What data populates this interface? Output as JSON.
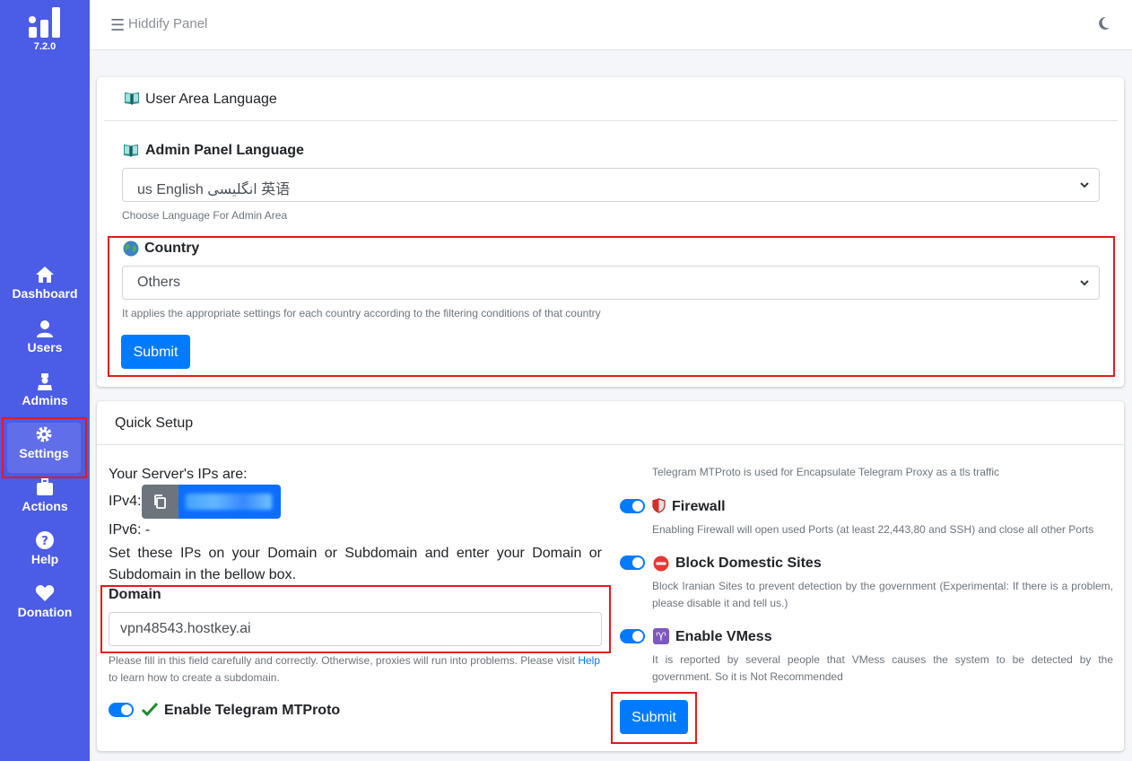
{
  "sidebar": {
    "version": "7.2.0",
    "items": [
      {
        "label": "Dashboard",
        "icon": "home-icon"
      },
      {
        "label": "Users",
        "icon": "user-icon"
      },
      {
        "label": "Admins",
        "icon": "admin-icon"
      },
      {
        "label": "Settings",
        "icon": "gear-icon",
        "active": true
      },
      {
        "label": "Actions",
        "icon": "briefcase-icon"
      },
      {
        "label": "Help",
        "icon": "question-icon"
      },
      {
        "label": "Donation",
        "icon": "heart-icon"
      }
    ]
  },
  "header": {
    "title": "Hiddify Panel"
  },
  "user_area": {
    "title": "User Area Language",
    "admin_lang_label": "Admin Panel Language",
    "admin_lang_value": "us English انگلیسی 英语",
    "admin_lang_help": "Choose Language For Admin Area",
    "country_label": "Country",
    "country_value": "Others",
    "country_help": "It applies the appropriate settings for each country according to the filtering conditions of that country",
    "submit": "Submit"
  },
  "quick_setup": {
    "title": "Quick Setup",
    "server_ips": "Your Server's IPs are:",
    "ipv4_label": "IPv4:",
    "ipv6_label": "IPv6: -",
    "instruction": "Set these IPs on your Domain or Subdomain and enter your Domain or Subdomain in the bellow box.",
    "domain_label": "Domain",
    "domain_value": "vpn48543.hostkey.ai",
    "domain_help_1": "Please fill in this field carefully and correctly. Otherwise, proxies will run into problems. Please visit",
    "domain_help_link": "Help",
    "domain_help_2": "to learn how to create a subdomain.",
    "telegram_label": "Enable Telegram MTProto",
    "telegram_help": "Telegram MTProto is used for Encapsulate Telegram Proxy as a tls traffic",
    "firewall_label": "Firewall",
    "firewall_help": "Enabling Firewall will open used Ports (at least 22,443,80 and SSH) and close all other Ports",
    "block_label": "Block Domestic Sites",
    "block_help": "Block Iranian Sites to prevent detection by the government (Experimental: If there is a problem, please disable it and tell us.)",
    "vmess_label": "Enable VMess",
    "vmess_help": "It is reported by several people that VMess causes the system to be detected by the government. So it is Not Recommended",
    "submit": "Submit"
  },
  "colors": {
    "sidebar": "#4b5ce6",
    "primary": "#007bff",
    "highlight": "#e41a1a"
  }
}
